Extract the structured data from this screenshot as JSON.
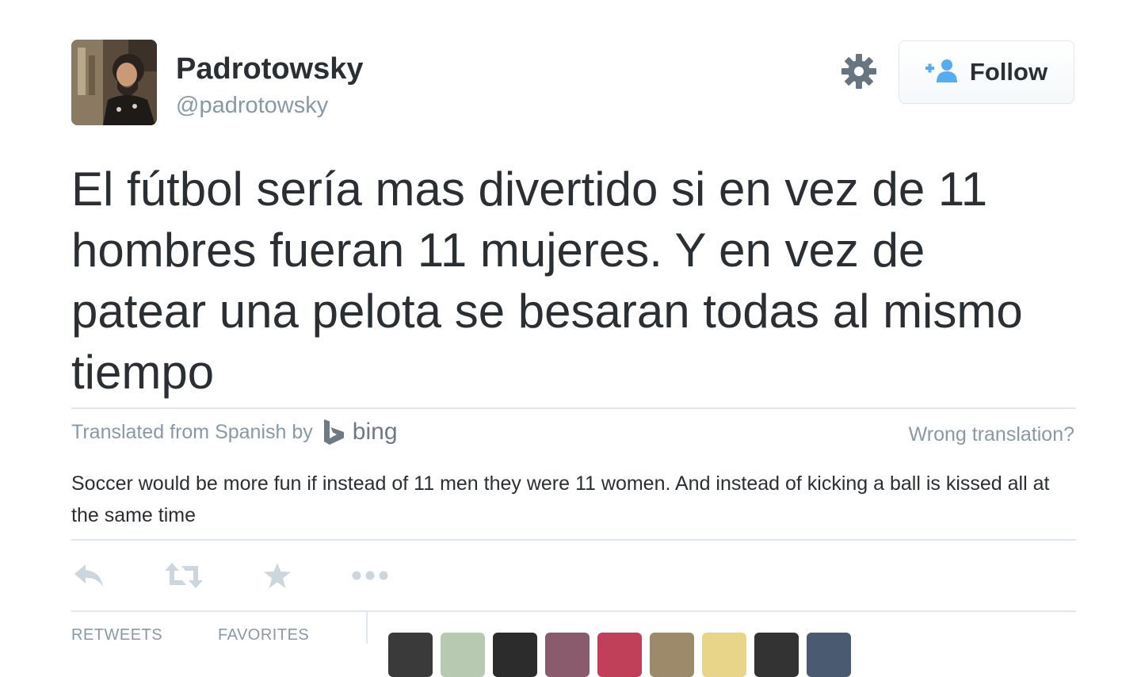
{
  "user": {
    "full_name": "Padrotowsky",
    "screen_name": "@padrotowsky"
  },
  "follow": {
    "label": "Follow"
  },
  "tweet": {
    "text": "El fútbol sería mas divertido si en vez de 11 hombres fueran 11 mujeres. Y en vez de patear una pelota se besaran todas al mismo tiempo"
  },
  "translation": {
    "attribution": "Translated from Spanish by",
    "provider": "bing",
    "wrong_link": "Wrong translation?",
    "text": "Soccer would be more fun if instead of 11 men they were 11 women. And instead of kicking a ball is kissed all at the same time"
  },
  "actions": {
    "icons": [
      "reply-icon",
      "retweet-icon",
      "favorite-icon",
      "more-icon"
    ]
  },
  "stats": {
    "retweets_label": "RETWEETS",
    "favorites_label": "FAVORITES"
  },
  "colors": {
    "text": "#292f33",
    "muted": "#8899a6",
    "border": "#e1e8ed",
    "accent": "#55acee",
    "action_icon": "#ccd6dd"
  }
}
